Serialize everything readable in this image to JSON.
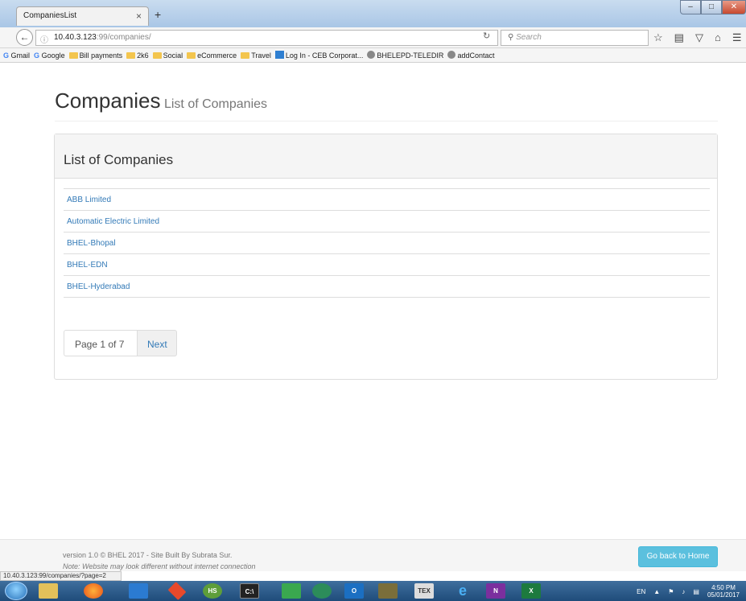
{
  "browser": {
    "tab_title": "CompaniesList",
    "tab_close": "×",
    "new_tab": "+",
    "url_host": "10.40.3.123",
    "url_rest": ":99/companies/",
    "search_placeholder": "Search",
    "status_url": "10.40.3.123:99/companies/?page=2",
    "bookmarks": [
      "Gmail",
      "Google",
      "Bill payments",
      "2k6",
      "Social",
      "eCommerce",
      "Travel",
      "Log In - CEB Corporat...",
      "BHELEPD-TELEDIR",
      "addContact"
    ]
  },
  "page": {
    "title": "Companies",
    "subtitle": "List of Companies",
    "panel_title": "List of Companies",
    "companies": [
      "ABB Limited",
      "Automatic Electric Limited",
      "BHEL-Bhopal",
      "BHEL-EDN",
      "BHEL-Hyderabad"
    ],
    "pagination": {
      "info": "Page 1 of 7",
      "next": "Next"
    }
  },
  "footer": {
    "version": "version 1.0 © BHEL 2017 - Site Built By Subrata Sur.",
    "note": "Note: Website may look different without internet connection",
    "home_button": "Go back to Home"
  },
  "taskbar": {
    "lang": "EN",
    "time": "4:50 PM",
    "date": "05/01/2017"
  }
}
